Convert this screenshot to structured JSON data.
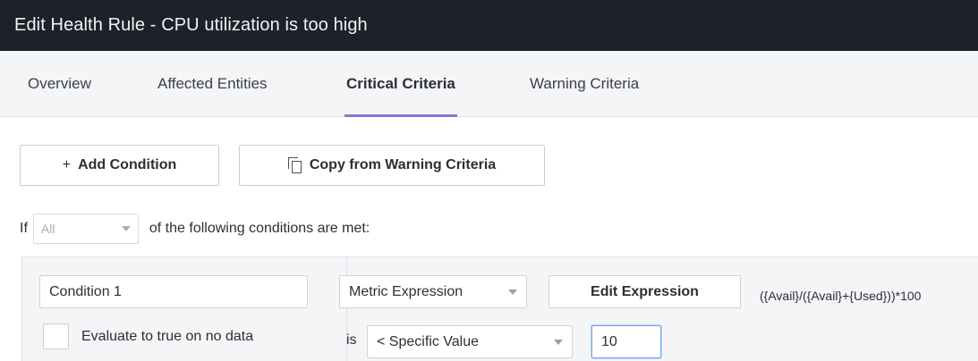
{
  "window": {
    "title": "Edit Health Rule - CPU utilization is too high"
  },
  "tabs": [
    {
      "label": "Overview",
      "active": false
    },
    {
      "label": "Affected Entities",
      "active": false
    },
    {
      "label": "Critical Criteria",
      "active": true
    },
    {
      "label": "Warning Criteria",
      "active": false
    }
  ],
  "toolbar": {
    "add_condition_icon": "plus-icon",
    "add_condition_symbol": "+",
    "add_condition_label": "Add Condition",
    "copy_icon": "copy-icon",
    "copy_label": "Copy from Warning Criteria"
  },
  "match": {
    "if_label": "If",
    "selected": "All",
    "suffix": "of the following conditions are met:"
  },
  "condition": {
    "name": "Condition 1",
    "metric_type": "Metric Expression",
    "edit_expression_label": "Edit Expression",
    "expression": "({Avail}/({Avail}+{Used}))*100",
    "evaluate_no_data_label": "Evaluate to true on no data",
    "evaluate_no_data_checked": false,
    "is_label": "is",
    "operator": "< Specific Value",
    "value": "10"
  },
  "colors": {
    "titlebar": "#1d2129",
    "tabbar": "#f4f5f7",
    "active_tab_underline": "#7e78d4",
    "focus_border": "#6ea6e8"
  }
}
